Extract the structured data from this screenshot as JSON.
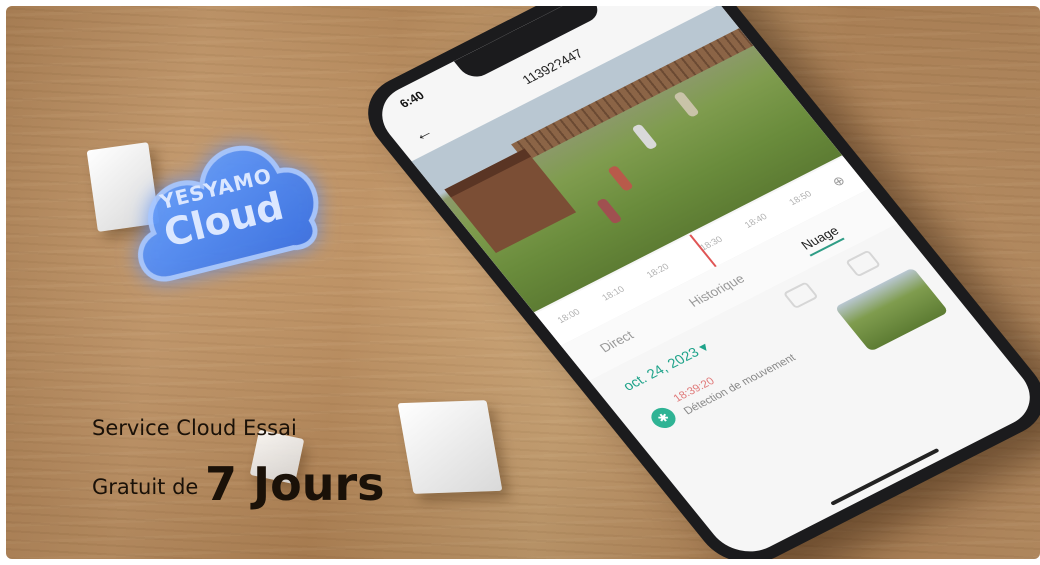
{
  "logo": {
    "brand": "YESYAMO",
    "name": "Cloud"
  },
  "promo": {
    "line1": "Service Cloud Essai",
    "line2_prefix": "Gratuit de",
    "line2_highlight": "7 Jours"
  },
  "phone": {
    "status_time": "6:40",
    "device_id": "11392?447",
    "timeline_ticks": [
      "18:00",
      "18:10",
      "18:20",
      "18:30",
      "18:40",
      "18:50"
    ],
    "tabs": [
      "Direct",
      "Historique",
      "Nuage"
    ],
    "active_tab": "Nuage",
    "date": "oct. 24, 2023",
    "event": {
      "time": "18:39:20",
      "type": "Détection de mouvement"
    },
    "accent_color": "#1fa38a"
  }
}
